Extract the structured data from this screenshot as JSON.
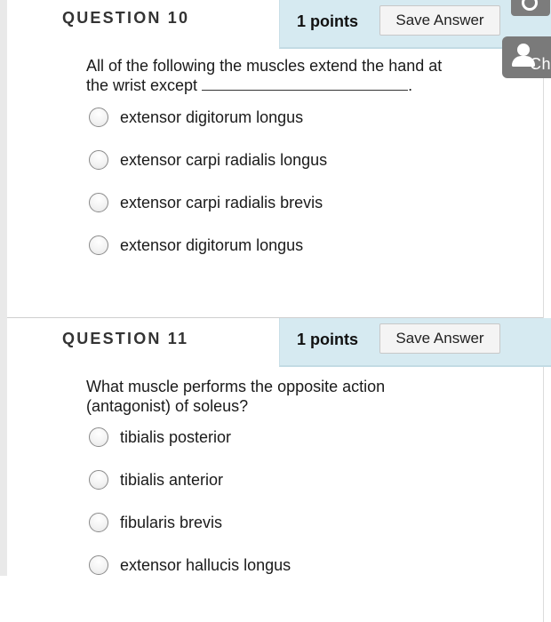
{
  "questions": [
    {
      "title": "QUESTION 10",
      "points": "1 points",
      "save_label": "Save Answer",
      "prompt_line1": "All of the following the muscles extend the hand at",
      "prompt_line2_before": "the wrist except",
      "prompt_line2_after": ".",
      "options": [
        "extensor digitorum longus",
        "extensor carpi radialis longus",
        "extensor carpi radialis brevis",
        "extensor digitorum longus"
      ]
    },
    {
      "title": "QUESTION 11",
      "points": "1 points",
      "save_label": "Save Answer",
      "prompt_line1": "What muscle performs the opposite action",
      "prompt_line2": "(antagonist) of soleus?",
      "options": [
        "tibialis posterior",
        "tibialis anterior",
        "fibularis brevis",
        "extensor hallucis longus"
      ]
    }
  ],
  "chat_widget": {
    "label": "Ch",
    "icon": "person-icon"
  },
  "top_widget": {
    "icon": "power-icon"
  },
  "colors": {
    "header_bg": "#d6eaf1",
    "widget_bg": "#7a7a7a"
  }
}
